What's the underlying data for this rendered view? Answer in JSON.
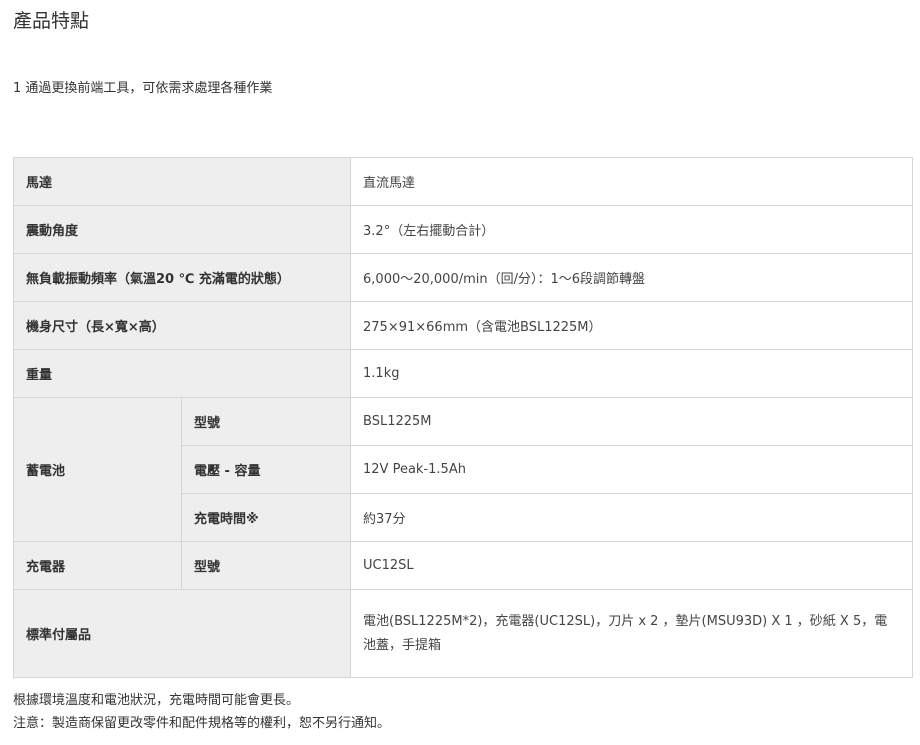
{
  "page_title": "產品特點",
  "feature": "1 通過更換前端工具，可依需求處理各種作業",
  "spec": {
    "motor": {
      "label": "馬達",
      "value": "直流馬達"
    },
    "angle": {
      "label": "震動角度",
      "value": "3.2°（左右擺動合計）"
    },
    "freq": {
      "label": "無負載振動頻率（氣溫20 ℃ 充滿電的狀態）",
      "value": "6,000～20,000/min（回/分）：1～6段調節轉盤"
    },
    "size": {
      "label": "機身尺寸（長×寬×高）",
      "value": "275×91×66mm（含電池BSL1225M）"
    },
    "weight": {
      "label": "重量",
      "value": "1.1kg"
    },
    "battery": {
      "label": "蓄電池",
      "model_label": "型號",
      "model_value": "BSL1225M",
      "volt_label": "電壓 - 容量",
      "volt_value": "12V Peak-1.5Ah",
      "charge_label": "充電時間※",
      "charge_value": "約37分"
    },
    "charger": {
      "label": "充電器",
      "model_label": "型號",
      "model_value": "UC12SL"
    },
    "accessories": {
      "label": "標準付屬品",
      "value": "電池(BSL1225M*2)，充電器(UC12SL)，刀片 x 2 ，墊片(MSU93D) X 1 ，砂紙 X 5，電池蓋，手提箱"
    }
  },
  "notes": {
    "line1": "根據環境溫度和電池狀況，充電時間可能會更長。",
    "line2": "注意：製造商保留更改零件和配件規格等的權利，恕不另行通知。"
  }
}
